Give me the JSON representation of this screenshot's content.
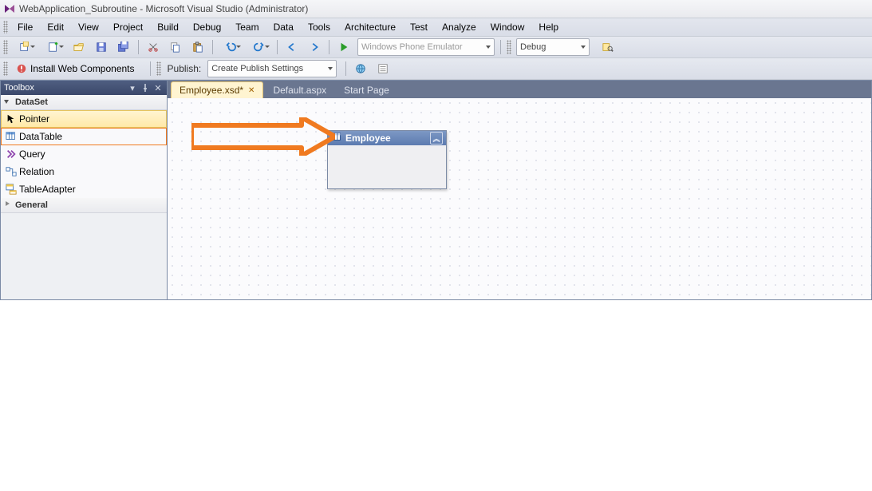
{
  "titlebar": {
    "text": "WebApplication_Subroutine - Microsoft Visual Studio (Administrator)"
  },
  "menubar": {
    "items": [
      "File",
      "Edit",
      "View",
      "Project",
      "Build",
      "Debug",
      "Team",
      "Data",
      "Tools",
      "Architecture",
      "Test",
      "Analyze",
      "Window",
      "Help"
    ]
  },
  "toolbar1": {
    "target_combo": "Windows Phone Emulator",
    "config_combo": "Debug"
  },
  "toolbar2": {
    "install_label": "Install Web Components",
    "publish_label": "Publish:",
    "publish_combo": "Create Publish Settings"
  },
  "toolbox": {
    "title": "Toolbox",
    "categories": [
      {
        "label": "DataSet",
        "expanded": true
      },
      {
        "label": "General",
        "expanded": false
      }
    ],
    "items": [
      {
        "label": "Pointer",
        "icon": "pointer-icon",
        "selected": true
      },
      {
        "label": "DataTable",
        "icon": "datatable-icon",
        "highlight": true
      },
      {
        "label": "Query",
        "icon": "query-icon"
      },
      {
        "label": "Relation",
        "icon": "relation-icon"
      },
      {
        "label": "TableAdapter",
        "icon": "tableadapter-icon"
      }
    ]
  },
  "tabs": [
    {
      "label": "Employee.xsd*",
      "active": true,
      "closeable": true
    },
    {
      "label": "Default.aspx",
      "active": false
    },
    {
      "label": "Start Page",
      "active": false
    }
  ],
  "designer": {
    "table_name": "Employee"
  },
  "icons": {
    "pointer": "pointer",
    "datatable": "datatable",
    "query": "query",
    "relation": "relation",
    "tableadapter": "tableadapter"
  },
  "colors": {
    "accent_orange": "#f07a20",
    "vs_blue": "#5c7bb0",
    "panel_dark": "#3b486a"
  }
}
